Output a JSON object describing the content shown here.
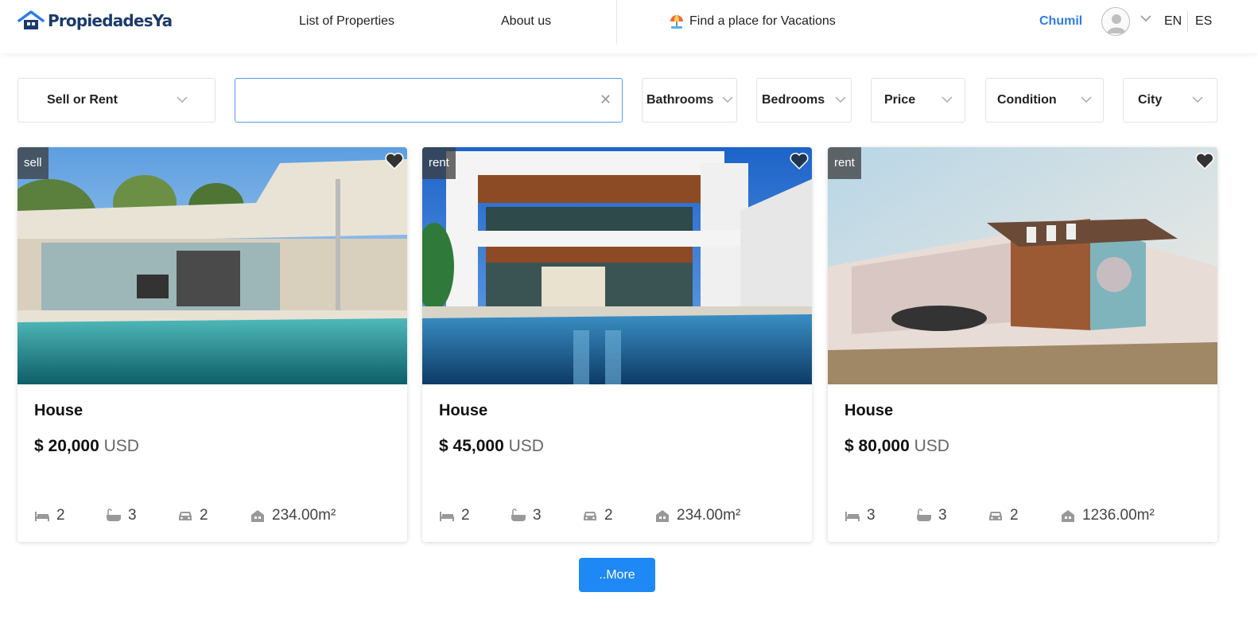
{
  "brand": {
    "name": "PropiedadesYa",
    "color": "#1c3b6b",
    "icon": "house-logo-icon"
  },
  "nav": {
    "list_of_properties": "List of Properties",
    "about_us": "About us",
    "vacations": "Find a place for Vacations",
    "vacations_icon": "beach-umbrella-icon"
  },
  "user": {
    "name": "Chumil",
    "avatar_icon": "user-avatar-icon"
  },
  "languages": [
    "EN",
    "ES"
  ],
  "filters": {
    "sell_or_rent": "Sell or Rent",
    "search_value": "",
    "bathrooms": "Bathrooms",
    "bedrooms": "Bedrooms",
    "price": "Price",
    "condition": "Condition",
    "city": "City"
  },
  "listings": [
    {
      "badge": "sell",
      "title": "House",
      "price": "$ 20,000",
      "currency": "USD",
      "bedrooms": "2",
      "bathrooms": "3",
      "parking": "2",
      "area": "234.00m²"
    },
    {
      "badge": "rent",
      "title": "House",
      "price": "$ 45,000",
      "currency": "USD",
      "bedrooms": "2",
      "bathrooms": "3",
      "parking": "2",
      "area": "234.00m²"
    },
    {
      "badge": "rent",
      "title": "House",
      "price": "$ 80,000",
      "currency": "USD",
      "bedrooms": "3",
      "bathrooms": "3",
      "parking": "2",
      "area": "1236.00m²"
    }
  ],
  "more_button": "..More",
  "colors": {
    "accent": "#2f7be6",
    "button": "#1e88f5",
    "badge_bg": "#3c3c3c"
  }
}
